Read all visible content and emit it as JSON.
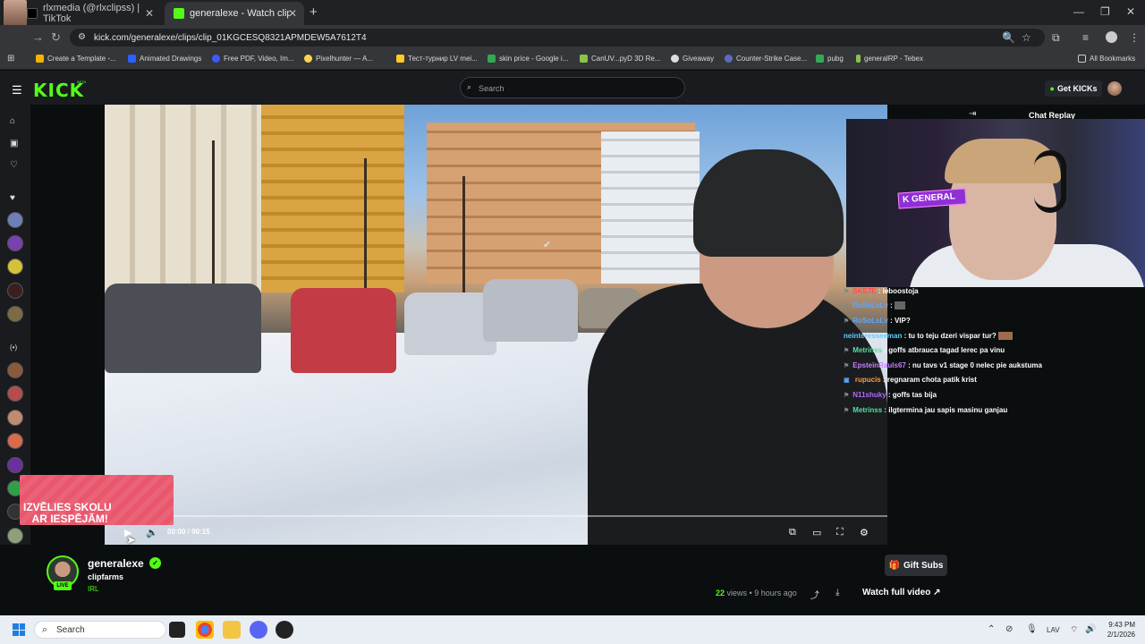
{
  "browser": {
    "tabs": [
      {
        "title": "rlxmedia (@rlxclipss) | TikTok",
        "active": false
      },
      {
        "title": "generalexe - Watch clips on Kic",
        "active": true
      }
    ],
    "url": "kick.com/generalexe/clips/clip_01KGCESQ8321APMDEW5A7612T4",
    "bookmarks": [
      "Create a Template -...",
      "Animated Drawings",
      "Free PDF, Video, Im...",
      "Pixelhunter — A...",
      "Тест-турнир LV mei...",
      "skin price - Google i...",
      "CanUV...pyD 3D Re...",
      "Giveaway",
      "Counter-Strike Case...",
      "pubg",
      "generalRP - Tebex"
    ],
    "all_bookmarks": "All Bookmarks"
  },
  "header": {
    "logo": "KICK",
    "logo_badge": "BETA",
    "search_placeholder": "Search",
    "get_kicks": "Get KICKs"
  },
  "player": {
    "time": "00:00 / 00:15",
    "ad_text": "IZVĒLIES SKOLU\n   AR IESPĒJĀM!"
  },
  "chat": {
    "title": "Chat Replay",
    "messages": [
      {
        "user": "SKE7E",
        "text": "ieboostoja",
        "color": "#ff4d4d"
      },
      {
        "user": "RoSoLsLv",
        "text": "",
        "color": "#5aa9ff"
      },
      {
        "user": "RoSoLsLv",
        "text": "VIP?",
        "color": "#5aa9ff"
      },
      {
        "user": "neinteresseeman",
        "text": "tu to teju dzeri vispar tur?",
        "color": "#5ad1ff"
      },
      {
        "user": "Metrinss",
        "text": "goffs atbrauca tagad lerec pa vinu",
        "color": "#53e0a0"
      },
      {
        "user": "EpsteinRauls67",
        "text": "nu tavs v1 stage 0 nelec pie aukstuma",
        "color": "#c77dff"
      },
      {
        "user": "rupucis",
        "text": "regnaram chota patik krist",
        "color": "#ff9a3c"
      },
      {
        "user": "N11shuky",
        "text": "goffs tas bija",
        "color": "#b06bff"
      },
      {
        "user": "Metrinss",
        "text": "ilgtermina jau sapis masinu ganjau",
        "color": "#53e0a0"
      }
    ]
  },
  "channel": {
    "name": "generalexe",
    "live_badge": "LIVE",
    "clip_title": "clipfarms",
    "category": "IRL",
    "gift_subs": "Gift Subs",
    "views_count": "22",
    "views_label": "views",
    "age": "9 hours ago",
    "watch_full": "Watch full video"
  },
  "taskbar": {
    "search_placeholder": "Search",
    "lang": "LAV",
    "time": "9:43 PM",
    "date": "2/1/2026"
  }
}
